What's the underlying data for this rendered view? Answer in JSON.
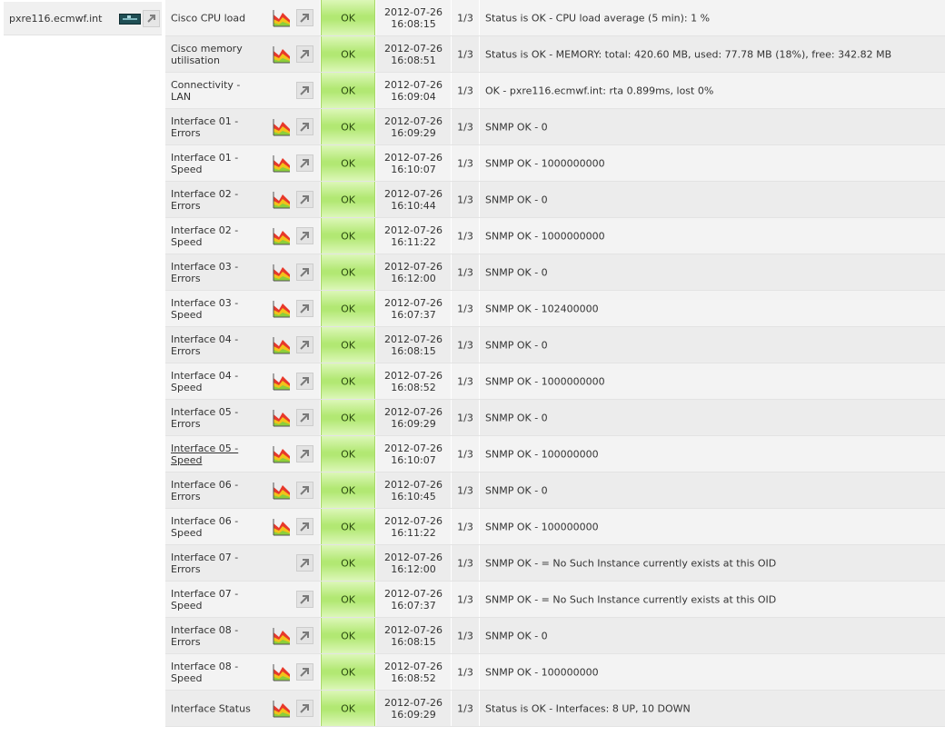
{
  "host": {
    "name": "pxre116.ecmwf.int"
  },
  "services": [
    {
      "name": "Cisco CPU load",
      "has_graph": true,
      "status": "OK",
      "date": "2012-07-26",
      "time": "16:08:15",
      "attempt": "1/3",
      "info": "Status is OK - CPU load average (5 min): 1 %"
    },
    {
      "name": "Cisco memory utilisation",
      "has_graph": true,
      "status": "OK",
      "date": "2012-07-26",
      "time": "16:08:51",
      "attempt": "1/3",
      "info": "Status is OK - MEMORY: total: 420.60 MB, used: 77.78 MB (18%), free: 342.82 MB"
    },
    {
      "name": "Connectivity - LAN",
      "has_graph": false,
      "status": "OK",
      "date": "2012-07-26",
      "time": "16:09:04",
      "attempt": "1/3",
      "info": "OK - pxre116.ecmwf.int: rta 0.899ms, lost 0%"
    },
    {
      "name": "Interface 01 - Errors",
      "has_graph": true,
      "status": "OK",
      "date": "2012-07-26",
      "time": "16:09:29",
      "attempt": "1/3",
      "info": "SNMP OK - 0"
    },
    {
      "name": "Interface 01 - Speed",
      "has_graph": true,
      "status": "OK",
      "date": "2012-07-26",
      "time": "16:10:07",
      "attempt": "1/3",
      "info": "SNMP OK - 1000000000"
    },
    {
      "name": "Interface 02 - Errors",
      "has_graph": true,
      "status": "OK",
      "date": "2012-07-26",
      "time": "16:10:44",
      "attempt": "1/3",
      "info": "SNMP OK - 0"
    },
    {
      "name": "Interface 02 - Speed",
      "has_graph": true,
      "status": "OK",
      "date": "2012-07-26",
      "time": "16:11:22",
      "attempt": "1/3",
      "info": "SNMP OK - 1000000000"
    },
    {
      "name": "Interface 03 - Errors",
      "has_graph": true,
      "status": "OK",
      "date": "2012-07-26",
      "time": "16:12:00",
      "attempt": "1/3",
      "info": "SNMP OK - 0"
    },
    {
      "name": "Interface 03 - Speed",
      "has_graph": true,
      "status": "OK",
      "date": "2012-07-26",
      "time": "16:07:37",
      "attempt": "1/3",
      "info": "SNMP OK - 102400000"
    },
    {
      "name": "Interface 04 - Errors",
      "has_graph": true,
      "status": "OK",
      "date": "2012-07-26",
      "time": "16:08:15",
      "attempt": "1/3",
      "info": "SNMP OK - 0"
    },
    {
      "name": "Interface 04 - Speed",
      "has_graph": true,
      "status": "OK",
      "date": "2012-07-26",
      "time": "16:08:52",
      "attempt": "1/3",
      "info": "SNMP OK - 1000000000"
    },
    {
      "name": "Interface 05 - Errors",
      "has_graph": true,
      "status": "OK",
      "date": "2012-07-26",
      "time": "16:09:29",
      "attempt": "1/3",
      "info": "SNMP OK - 0"
    },
    {
      "name": "Interface 05 - Speed",
      "has_graph": true,
      "underlined": true,
      "status": "OK",
      "date": "2012-07-26",
      "time": "16:10:07",
      "attempt": "1/3",
      "info": "SNMP OK - 100000000"
    },
    {
      "name": "Interface 06 - Errors",
      "has_graph": true,
      "status": "OK",
      "date": "2012-07-26",
      "time": "16:10:45",
      "attempt": "1/3",
      "info": "SNMP OK - 0"
    },
    {
      "name": "Interface 06 - Speed",
      "has_graph": true,
      "status": "OK",
      "date": "2012-07-26",
      "time": "16:11:22",
      "attempt": "1/3",
      "info": "SNMP OK - 100000000"
    },
    {
      "name": "Interface 07 - Errors",
      "has_graph": false,
      "status": "OK",
      "date": "2012-07-26",
      "time": "16:12:00",
      "attempt": "1/3",
      "info": "SNMP OK - = No Such Instance currently exists at this OID"
    },
    {
      "name": "Interface 07 - Speed",
      "has_graph": false,
      "status": "OK",
      "date": "2012-07-26",
      "time": "16:07:37",
      "attempt": "1/3",
      "info": "SNMP OK - = No Such Instance currently exists at this OID"
    },
    {
      "name": "Interface 08 - Errors",
      "has_graph": true,
      "status": "OK",
      "date": "2012-07-26",
      "time": "16:08:15",
      "attempt": "1/3",
      "info": "SNMP OK - 0"
    },
    {
      "name": "Interface 08 - Speed",
      "has_graph": true,
      "status": "OK",
      "date": "2012-07-26",
      "time": "16:08:52",
      "attempt": "1/3",
      "info": "SNMP OK - 100000000"
    },
    {
      "name": "Interface Status",
      "has_graph": true,
      "status": "OK",
      "date": "2012-07-26",
      "time": "16:09:29",
      "attempt": "1/3",
      "info": "Status is OK - Interfaces: 8 UP, 10 DOWN"
    }
  ],
  "colors": {
    "ok_green": "#b2e873",
    "row_bg": "#f3f3f3"
  },
  "icons": {
    "graph": "graph-icon",
    "external": "external-link-icon",
    "host_logo": "cisco-device-icon"
  }
}
